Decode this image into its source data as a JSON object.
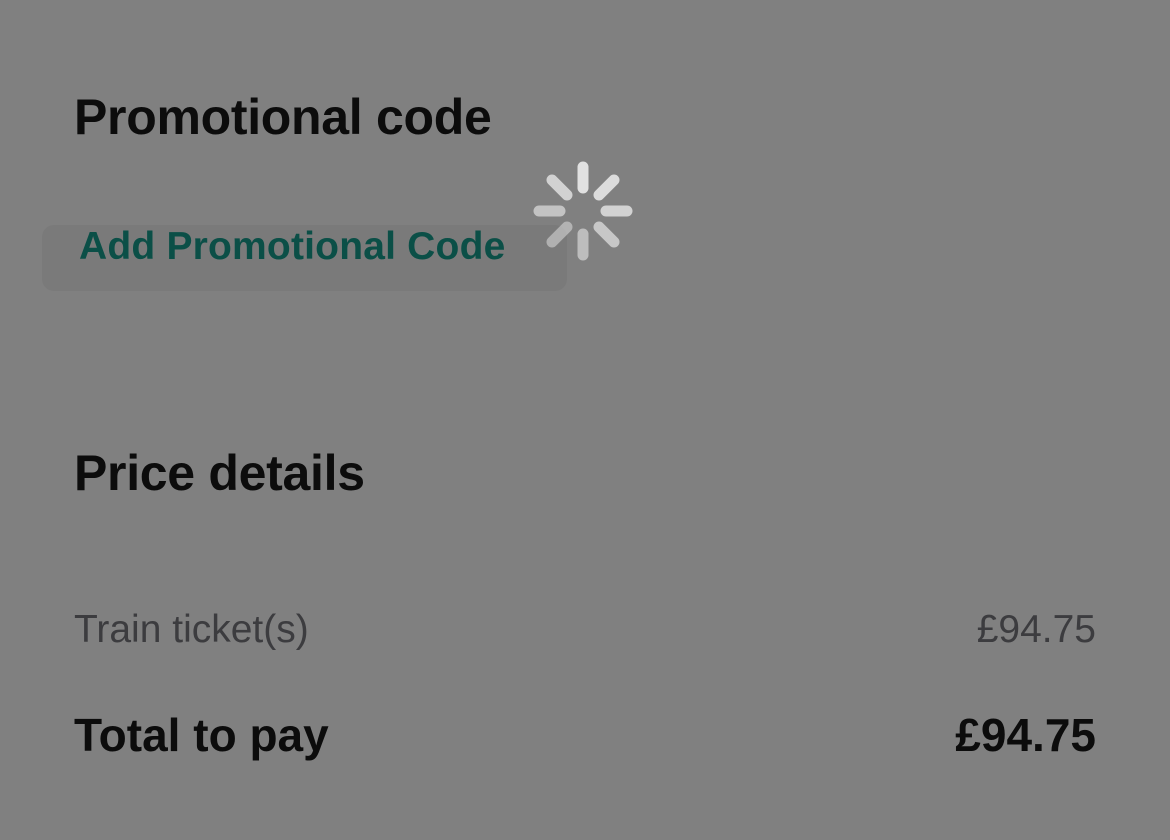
{
  "promo": {
    "title": "Promotional code",
    "button_label": "Add Promotional Code"
  },
  "price": {
    "title": "Price details",
    "rows": [
      {
        "label": "Train ticket(s)",
        "value": "£94.75"
      },
      {
        "label": "Total to pay",
        "value": "£94.75"
      }
    ]
  },
  "colors": {
    "overlay_background": "#808080",
    "accent_link": "#0b4f47",
    "heading_text": "#0c0c0c",
    "secondary_text": "#3c3c3f",
    "spinner": "#e6e6e6"
  },
  "icons": {
    "loading": "activity-spinner-icon"
  }
}
